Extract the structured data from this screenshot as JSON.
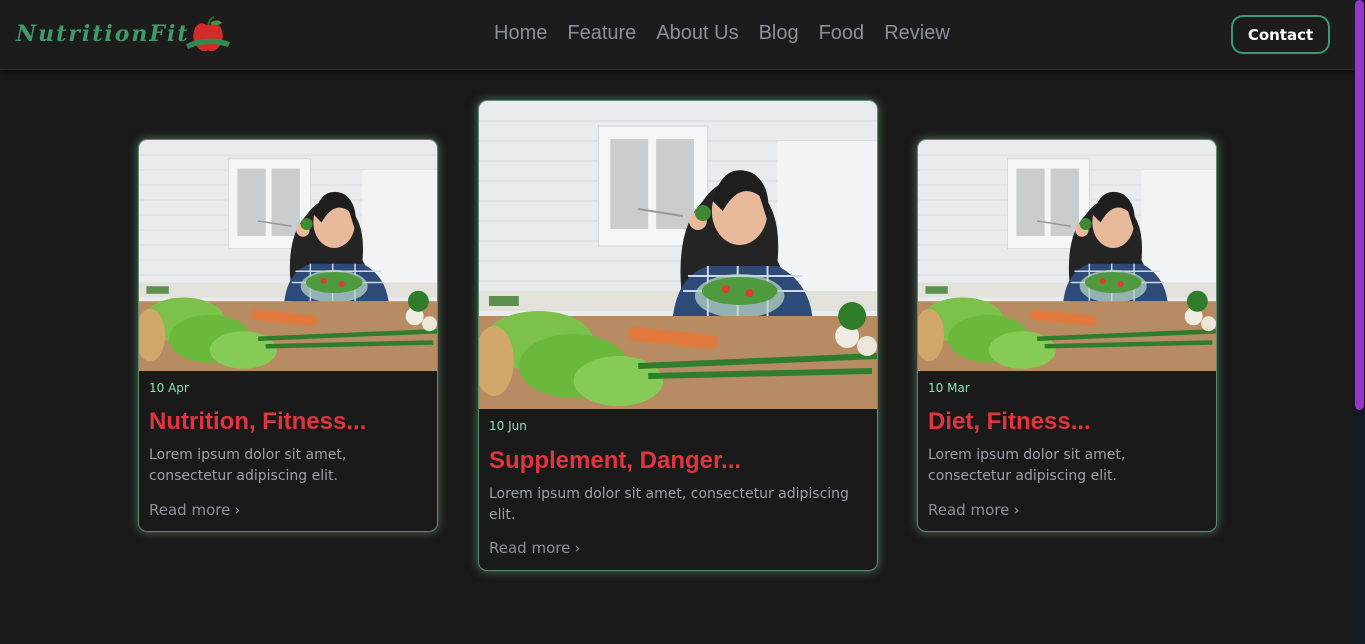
{
  "brand": {
    "logo_text": "NutritionFit",
    "accent": "#3f9a68"
  },
  "nav": {
    "links": [
      "Home",
      "Feature",
      "About Us",
      "Blog",
      "Food",
      "Review"
    ],
    "contact_label": "Contact"
  },
  "cards": [
    {
      "image": "woman-eating-salad-photo",
      "date": "10 Apr",
      "title": "Nutrition, Fitness...",
      "description": "Lorem ipsum dolor sit amet, consectetur adipiscing elit.",
      "read_more": "Read more",
      "chevron": "chevron-right-icon"
    },
    {
      "image": "woman-eating-salad-photo",
      "date": "10 Jun",
      "title": "Supplement, Danger...",
      "description": "Lorem ipsum dolor sit amet, consectetur adipiscing elit.",
      "read_more": "Read more",
      "chevron": "chevron-right-icon"
    },
    {
      "image": "woman-eating-salad-photo",
      "date": "10 Mar",
      "title": "Diet, Fitness...",
      "description": "Lorem ipsum dolor sit amet, consectetur adipiscing elit.",
      "read_more": "Read more",
      "chevron": "chevron-right-icon"
    }
  ],
  "colors": {
    "title": "#e0353f",
    "date": "#8fe0b0",
    "card_glow": "#84be96",
    "scroll_thumb": "#9b35c8"
  }
}
